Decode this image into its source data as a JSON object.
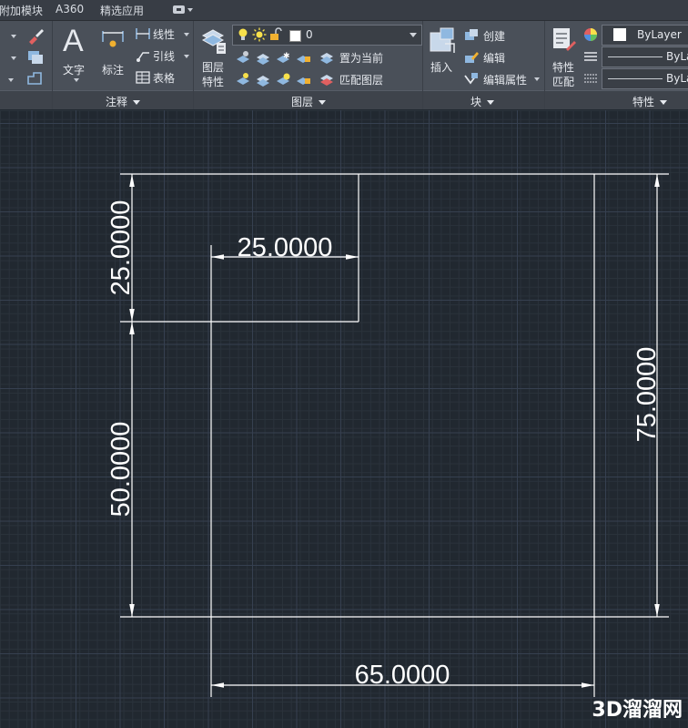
{
  "tabs": [
    "附加模块",
    "A360",
    "精选应用"
  ],
  "panels": {
    "annotation": {
      "title": "注释",
      "text_label": "文字",
      "dimension_label": "标注",
      "linear_label": "线性",
      "leader_label": "引线",
      "table_label": "表格"
    },
    "layers": {
      "title": "图层",
      "layer_properties_label": [
        "图层",
        "特性"
      ],
      "current_layer": "0",
      "make_current_label": "置为当前",
      "match_layer_label": "匹配图层"
    },
    "block": {
      "title": "块",
      "insert_label": "插入",
      "create_label": "创建",
      "edit_label": "编辑",
      "edit_attributes_label": "编辑属性"
    },
    "properties": {
      "title": "特性",
      "match_properties_label": [
        "特性",
        "匹配"
      ],
      "color_value": "ByLayer",
      "linetype_value": "ByLayer",
      "lineweight_value": "ByLayer"
    }
  },
  "drawing": {
    "dim_top_horizontal": "25.0000",
    "dim_left_upper": "25.0000",
    "dim_left_lower": "50.0000",
    "dim_right": "75.0000",
    "dim_bottom": "65.0000"
  },
  "watermark": "3D溜溜网",
  "colors": {
    "canvas_bg": "#212830",
    "ribbon_bg": "#4a5059",
    "tab_bar_bg": "#383d45",
    "geometry_line": "#ffffff"
  }
}
